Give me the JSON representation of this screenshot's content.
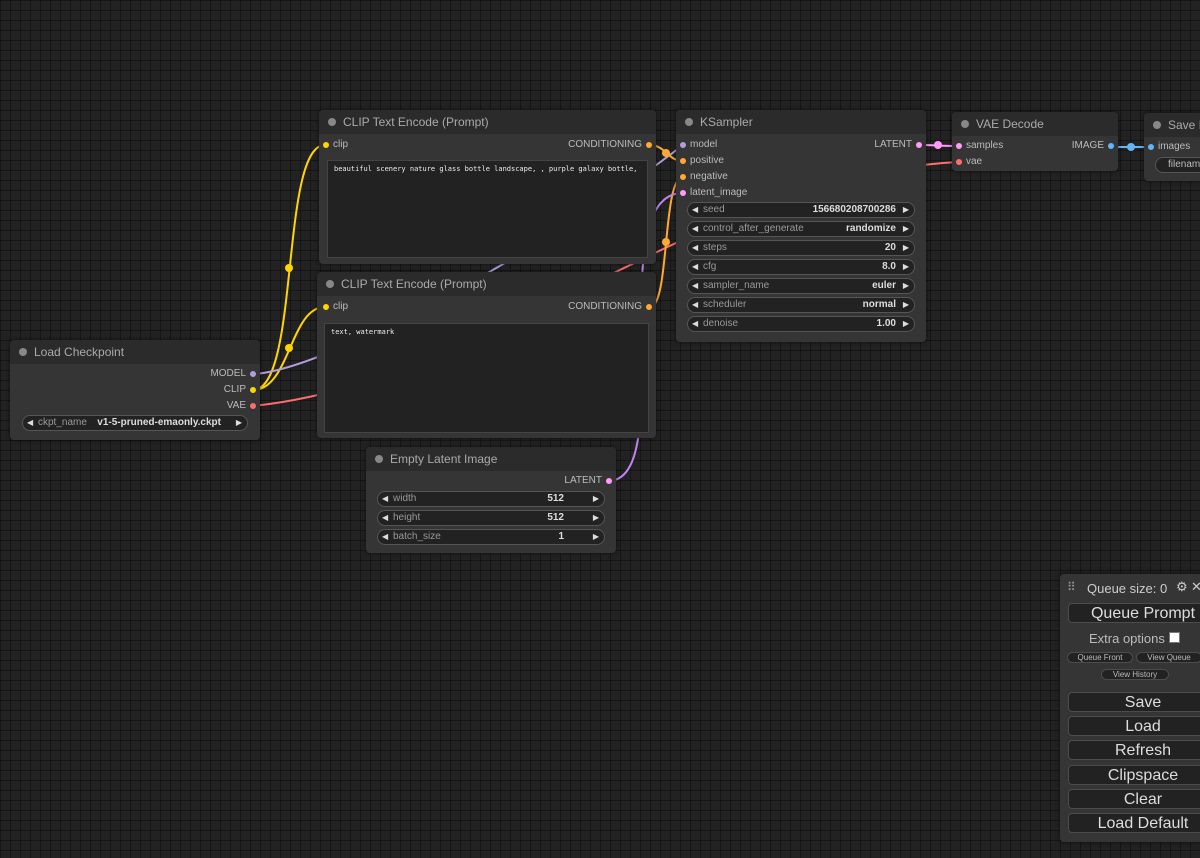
{
  "colors": {
    "clip": "#ffd500",
    "conditioning": "#ffa931",
    "model": "#b39ddb",
    "latent": "#ff9cf9",
    "vae": "#ff6e6e",
    "image": "#64b5f6"
  },
  "nodes": {
    "clip_pos": {
      "title": "CLIP Text Encode (Prompt)",
      "input": "clip",
      "output": "CONDITIONING",
      "text": "beautiful scenery nature glass bottle landscape, , purple galaxy bottle,"
    },
    "clip_neg": {
      "title": "CLIP Text Encode (Prompt)",
      "input": "clip",
      "output": "CONDITIONING",
      "text": "text, watermark"
    },
    "ksampler": {
      "title": "KSampler",
      "inputs": [
        "model",
        "positive",
        "negative",
        "latent_image"
      ],
      "output": "LATENT",
      "widgets": [
        {
          "name": "seed",
          "value": "156680208700286"
        },
        {
          "name": "control_after_generate",
          "value": "randomize"
        },
        {
          "name": "steps",
          "value": "20"
        },
        {
          "name": "cfg",
          "value": "8.0"
        },
        {
          "name": "sampler_name",
          "value": "euler"
        },
        {
          "name": "scheduler",
          "value": "normal"
        },
        {
          "name": "denoise",
          "value": "1.00"
        }
      ]
    },
    "vae_decode": {
      "title": "VAE Decode",
      "inputs": [
        "samples",
        "vae"
      ],
      "output": "IMAGE"
    },
    "save_image": {
      "title": "Save I",
      "input": "images",
      "widget": "filenam"
    },
    "load_checkpoint": {
      "title": "Load Checkpoint",
      "outputs": [
        "MODEL",
        "CLIP",
        "VAE"
      ],
      "widget": {
        "name": "ckpt_name",
        "value": "v1-5-pruned-emaonly.ckpt"
      }
    },
    "empty_latent": {
      "title": "Empty Latent Image",
      "output": "LATENT",
      "widgets": [
        {
          "name": "width",
          "value": "512"
        },
        {
          "name": "height",
          "value": "512"
        },
        {
          "name": "batch_size",
          "value": "1"
        }
      ]
    }
  },
  "menu": {
    "queue_size_label": "Queue size: 0",
    "queue_prompt": "Queue Prompt",
    "extra_options": "Extra options",
    "queue_front": "Queue Front",
    "view_queue": "View Queue",
    "view_history": "View History",
    "save": "Save",
    "load": "Load",
    "refresh": "Refresh",
    "clipspace": "Clipspace",
    "clear": "Clear",
    "load_default": "Load Default"
  }
}
